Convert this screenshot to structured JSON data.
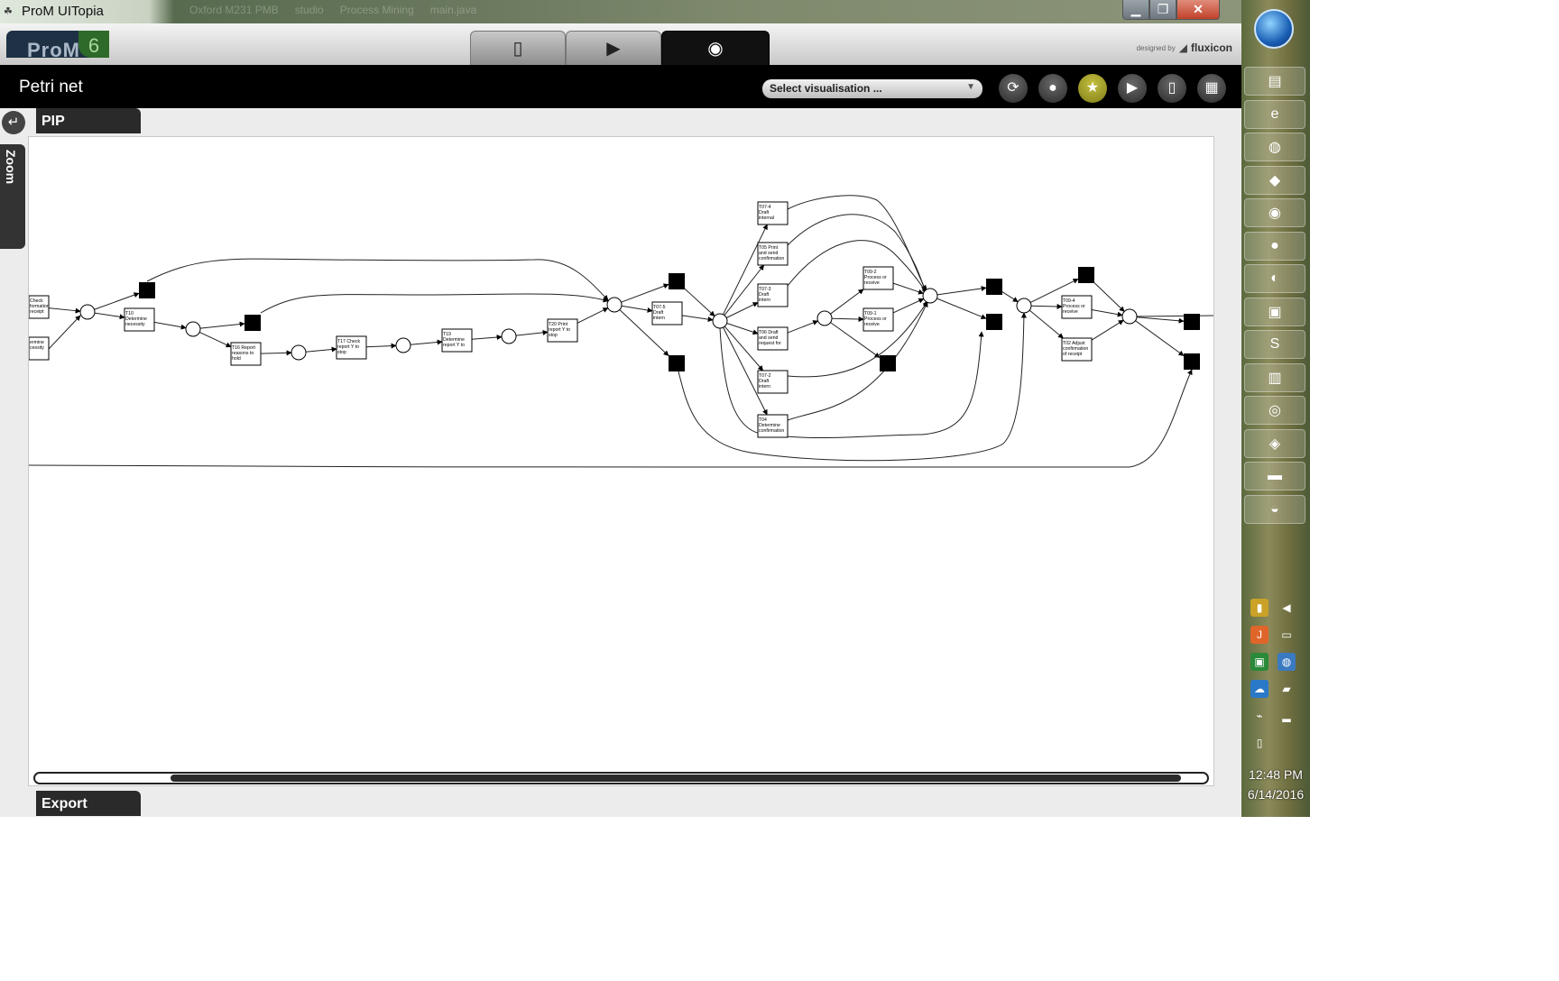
{
  "window": {
    "title": "ProM UITopia",
    "ghost_tabs": [
      "Oxford M231 PMB",
      "studio",
      "Process Mining",
      "main.java"
    ]
  },
  "window_buttons": {
    "minimize": "▁",
    "maximize": "❐",
    "close": "✕"
  },
  "header": {
    "logo_text": "ProM",
    "logo_version": "6",
    "tabs": [
      {
        "icon": "workspace-icon",
        "glyph": "▯"
      },
      {
        "icon": "play-icon",
        "glyph": "▶"
      },
      {
        "icon": "eye-icon",
        "glyph": "◉"
      }
    ],
    "credit_small": "designed by",
    "credit_brand": "fluxicon"
  },
  "viewbar": {
    "title": "Petri net",
    "select_placeholder": "Select visualisation ...",
    "buttons": [
      {
        "name": "refresh-icon",
        "glyph": "⟳"
      },
      {
        "name": "drop-icon",
        "glyph": "●"
      },
      {
        "name": "star-icon",
        "glyph": "★"
      },
      {
        "name": "play-icon",
        "glyph": "▶"
      },
      {
        "name": "copy-icon",
        "glyph": "▯"
      },
      {
        "name": "grid-icon",
        "glyph": "▦"
      }
    ]
  },
  "panel": {
    "back_glyph": "↵",
    "zoom_label": "Zoom",
    "pip_label": "PIP",
    "export_label": "Export"
  },
  "petri_net": {
    "transitions": [
      {
        "id": "t_check",
        "label": "Check\nformation\nreceipt"
      },
      {
        "id": "t_det",
        "label": "ermine\ncessity"
      },
      {
        "id": "t10",
        "label": "T10\nDetermine\nnecessity"
      },
      {
        "id": "t16",
        "label": "T16 Report\nreasons to\nhold"
      },
      {
        "id": "t17",
        "label": "T17 Check\nreport Y to\nstop"
      },
      {
        "id": "t19",
        "label": "T19\nDetermine\nreport Y to"
      },
      {
        "id": "t20",
        "label": "T20 Print\nreport Y to\nstop"
      },
      {
        "id": "t07_5",
        "label": "T07-5\nDraft\nintern"
      },
      {
        "id": "t07_4",
        "label": "T07-4\nDraft\ninternal"
      },
      {
        "id": "t05",
        "label": "T05 Print\nand send\nconfirmation"
      },
      {
        "id": "t07_3",
        "label": "T07-3\nDraft\nintern"
      },
      {
        "id": "t06",
        "label": "T06 Draft\nand send\nrequest for"
      },
      {
        "id": "t07_2",
        "label": "T07-2\nDraft\nintern"
      },
      {
        "id": "t04",
        "label": "T04\nDetermine\nconfirmation"
      },
      {
        "id": "t09_2",
        "label": "T09-2\nProcess or\nreceive"
      },
      {
        "id": "t09_1",
        "label": "T09-1\nProcess or\nreceive"
      },
      {
        "id": "t09_4",
        "label": "T09-4\nProcess or\nreceive"
      },
      {
        "id": "t02",
        "label": "T02 Adjust\nconfirmation\nof receipt"
      }
    ]
  },
  "taskbar": {
    "buttons": [
      {
        "name": "explorer-icon",
        "glyph": "▤"
      },
      {
        "name": "ie-icon",
        "glyph": "e"
      },
      {
        "name": "firefox-icon",
        "glyph": "◍"
      },
      {
        "name": "folder-icon",
        "glyph": "◆"
      },
      {
        "name": "chrome-icon",
        "glyph": "◉"
      },
      {
        "name": "eclipse-icon",
        "glyph": "●"
      },
      {
        "name": "app-icon",
        "glyph": "◐"
      },
      {
        "name": "notepad-icon",
        "glyph": "▣"
      },
      {
        "name": "sync-icon",
        "glyph": "S"
      },
      {
        "name": "database-icon",
        "glyph": "▥"
      },
      {
        "name": "network-icon",
        "glyph": "◎"
      },
      {
        "name": "globe-icon",
        "glyph": "◈"
      },
      {
        "name": "terminal-icon",
        "glyph": "▬"
      },
      {
        "name": "paint-icon",
        "glyph": "◒"
      }
    ],
    "clock_time": "12:48 PM",
    "clock_date": "6/14/2016"
  }
}
